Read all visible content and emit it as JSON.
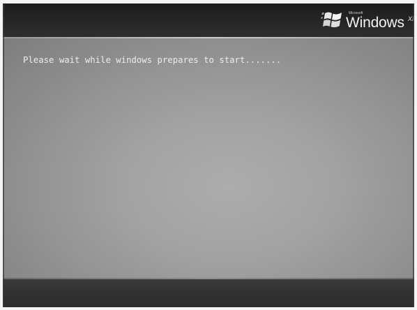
{
  "header": {
    "logo": {
      "icon": "windows-flag-icon",
      "brand": "Microsoft",
      "product": "Windows",
      "edition": "XP"
    }
  },
  "main": {
    "status_text": "Please wait while windows prepares to start......."
  },
  "colors": {
    "top_bar": "#262626",
    "main_background": "#a0a0a0",
    "bottom_bar": "#333333",
    "status_text": "#ececec",
    "logo_text": "#f2f2f2"
  }
}
